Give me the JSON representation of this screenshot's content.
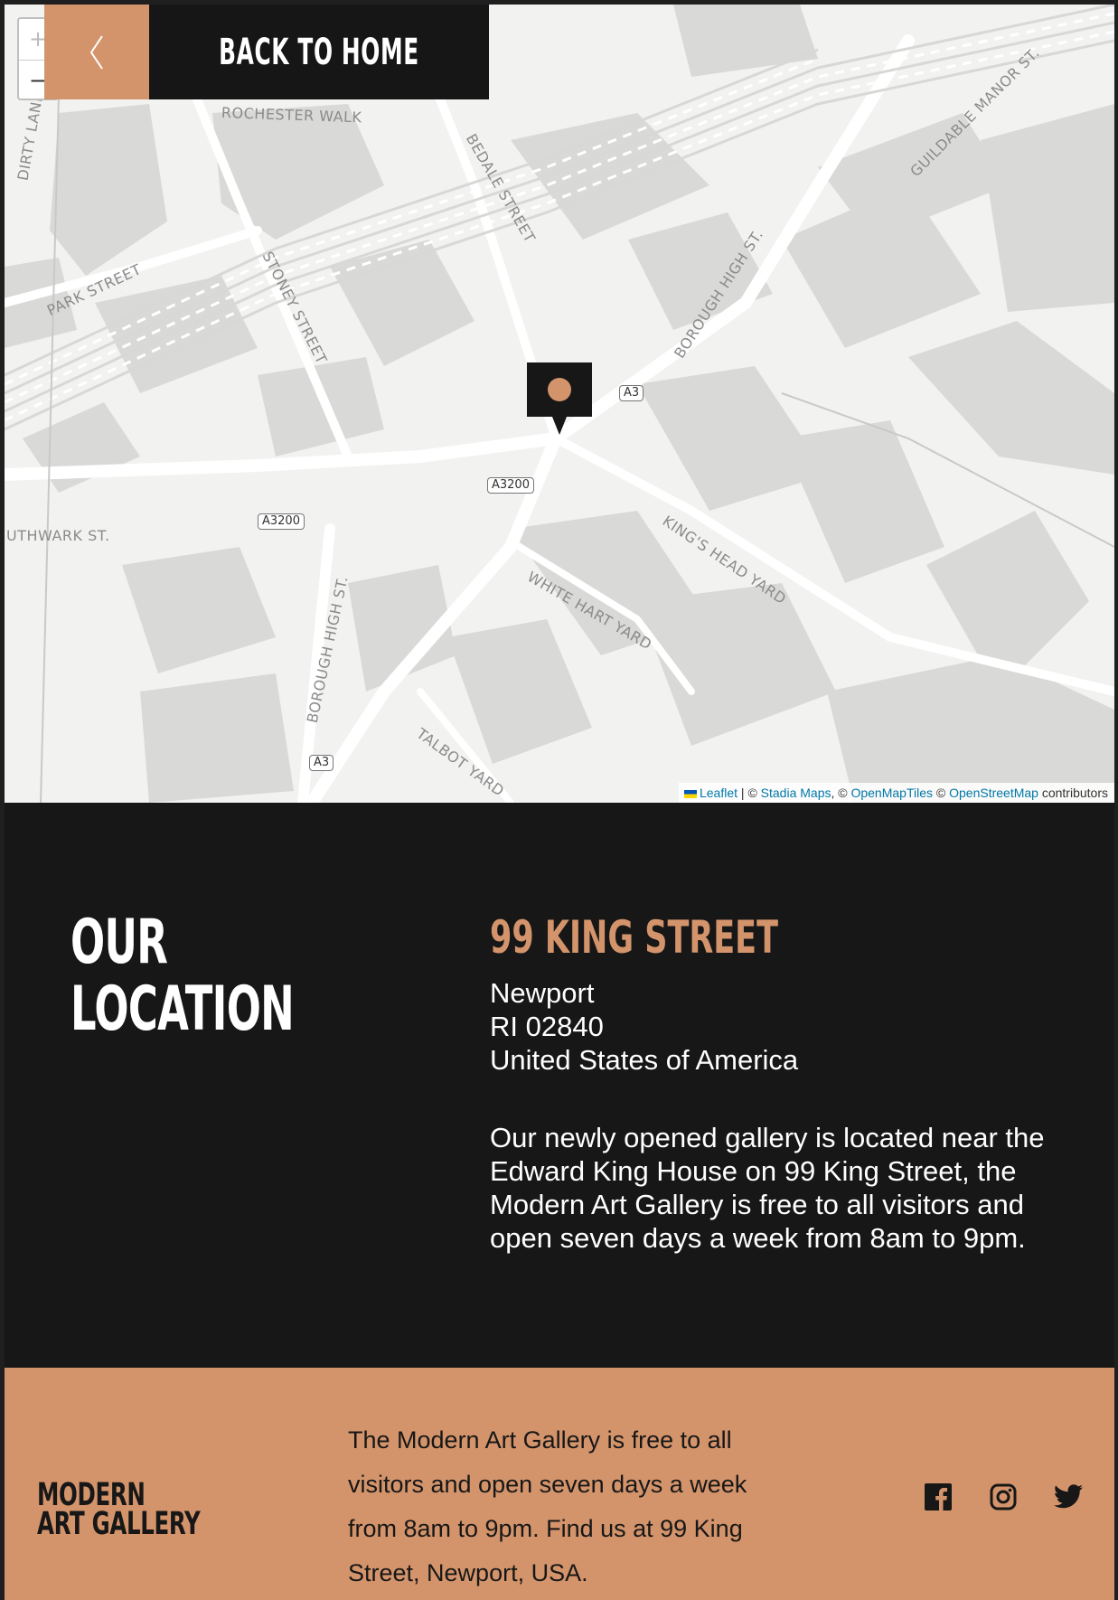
{
  "nav": {
    "back_label": "BACK TO HOME",
    "zoom_in": "+",
    "zoom_out": "−"
  },
  "map": {
    "streets": [
      "ROCHESTER WALK",
      "BEDALE STREET",
      "GUILDABLE MANOR ST.",
      "DIRTY LANE",
      "PARK STREET",
      "STONEY STREET",
      "BOROUGH HIGH ST.",
      "UTHWARK ST.",
      "KING'S HEAD YARD",
      "WHITE HART YARD",
      "TALBOT YARD"
    ],
    "road_shields": [
      "A3",
      "A3200",
      "A3200",
      "A3"
    ],
    "attribution": {
      "leaflet": "Leaflet",
      "sep1": " | © ",
      "stadia": "Stadia Maps",
      "sep2": ", © ",
      "openmaptiles": "OpenMapTiles",
      "sep3": " © ",
      "osm": "OpenStreetMap",
      "suffix": " contributors"
    },
    "pin_color": "#d4946b"
  },
  "location": {
    "heading_line1": "OUR",
    "heading_line2": "LOCATION",
    "title": "99 KING STREET",
    "address_line1": "Newport",
    "address_line2": "RI 02840",
    "address_line3": "United States of America",
    "description": "Our newly opened gallery is located near the Edward King House on 99 King Street, the Modern Art Gallery is free to all visitors and open seven days a week from 8am to 9pm."
  },
  "footer": {
    "logo_line1": "MODERN",
    "logo_line2": "ART GALLERY",
    "text": "The Modern Art Gallery is free to all visitors and open seven days a week from 8am to 9pm. Find us at 99 King Street, Newport, USA.",
    "social_icons": [
      "facebook-icon",
      "instagram-icon",
      "twitter-icon"
    ]
  },
  "colors": {
    "accent": "#d4946b",
    "dark": "#171717",
    "map_bg": "#f2f2f0"
  }
}
